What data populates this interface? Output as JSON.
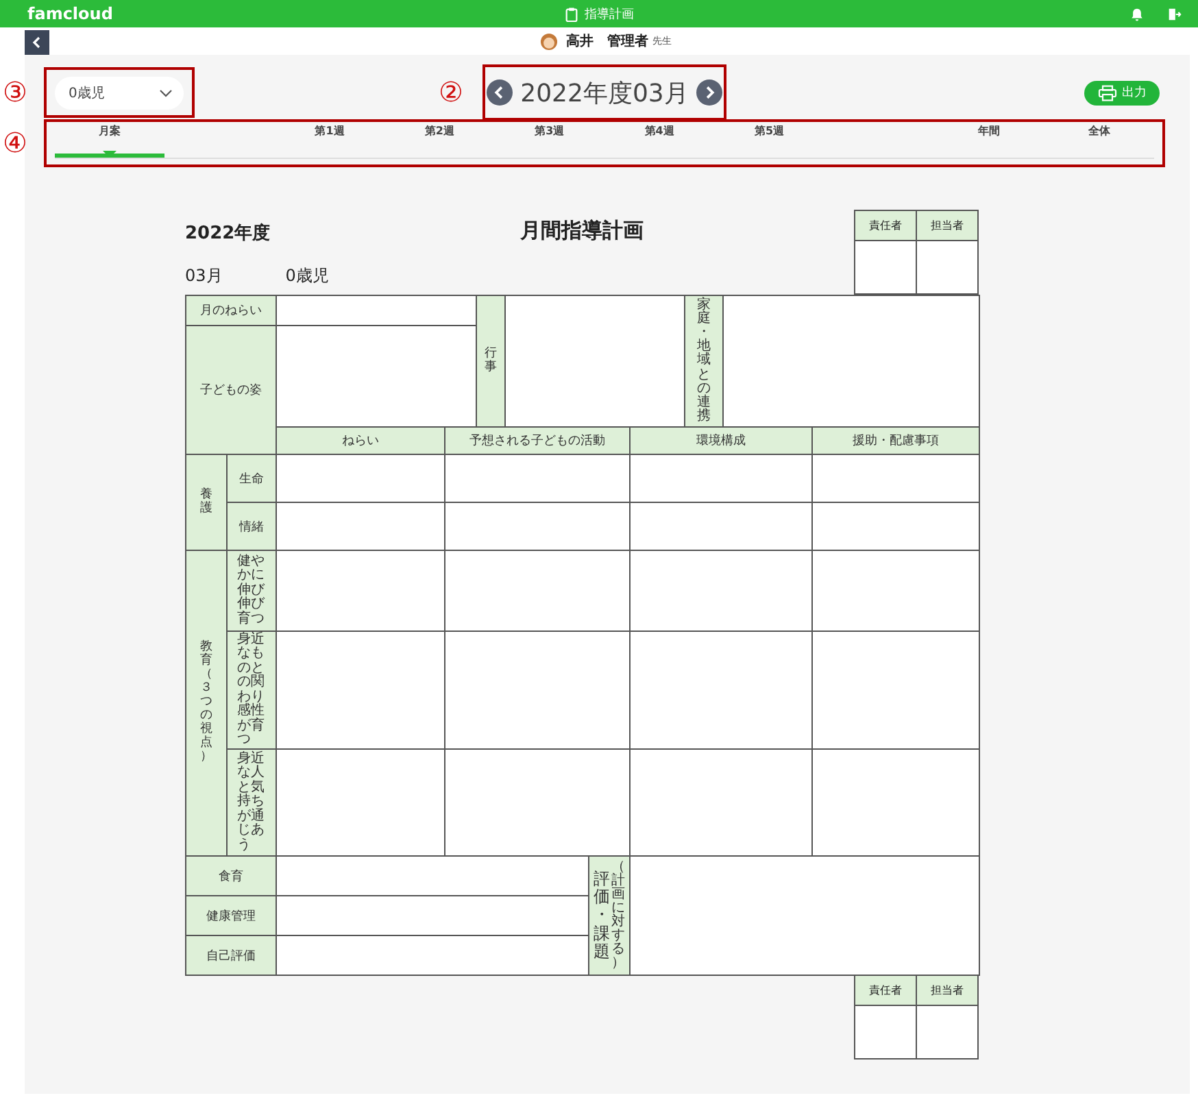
{
  "top_bar": {
    "logo": "famcloud",
    "title": "指導計画"
  },
  "user_bar": {
    "name": "高井　管理者",
    "role": "先生"
  },
  "class_select": {
    "value": "0歳児",
    "callout": "③"
  },
  "date_nav": {
    "label": "2022年度03月",
    "callout": "②"
  },
  "output_button": {
    "label": "出力"
  },
  "tabs_callout": "④",
  "tabs": [
    {
      "label": "月案",
      "selected": true
    },
    {
      "label": "第1週",
      "selected": false
    },
    {
      "label": "第2週",
      "selected": false
    },
    {
      "label": "第3週",
      "selected": false
    },
    {
      "label": "第4週",
      "selected": false
    },
    {
      "label": "第5週",
      "selected": false
    },
    {
      "label": "年間",
      "selected": false
    },
    {
      "label": "全体",
      "selected": false
    }
  ],
  "form": {
    "fiscal_year": "2022年度",
    "title": "月間指導計画",
    "month": "03月",
    "class": "0歳児",
    "approval_top": [
      "責任者",
      "担当者"
    ],
    "monthly_aim": "月のねらい",
    "child_state": "子どもの姿",
    "events": "行事",
    "family_link": "家庭・地域との連携",
    "columns": [
      "ねらい",
      "予想される子どもの活動",
      "環境構成",
      "援助・配慮事項"
    ],
    "care": {
      "label": "養護",
      "rows": [
        "生命",
        "情緒"
      ]
    },
    "education": {
      "label": "教育（３つの視点）",
      "rows": [
        "健やかに伸び伸び育つ",
        "身近なものとの関わり感性が育つ",
        "身近な人と気持ちが通じあう"
      ]
    },
    "bottom_rows": [
      "食育",
      "健康管理",
      "自己評価"
    ],
    "evaluation": {
      "label": "評価・課題",
      "note": "（計画に対する）"
    },
    "approval_bottom": [
      "責任者",
      "担当者"
    ]
  }
}
